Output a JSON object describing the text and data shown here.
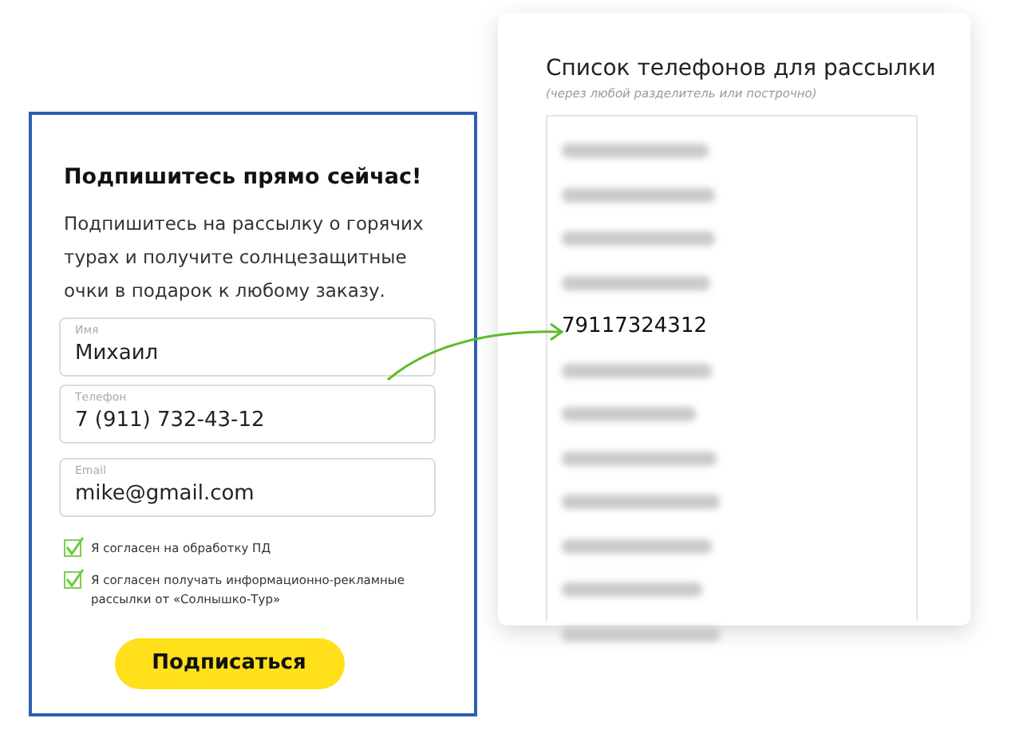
{
  "form": {
    "title": "Подпишитесь прямо сейчас!",
    "description": "Подпишитесь на рассылку о горячих турах и получите солнцезащитные очки в подарок к любому заказу.",
    "fields": [
      {
        "label": "Имя",
        "value": "Михаил"
      },
      {
        "label": "Телефон",
        "value": "7 (911) 732-43-12"
      },
      {
        "label": "Email",
        "value": "mike@gmail.com"
      }
    ],
    "consents": [
      {
        "label": "Я согласен на обработку ПД",
        "checked": true
      },
      {
        "label": "Я согласен получать информационно-рекламные рассылки от «Солнышко-Тур»",
        "checked": true
      }
    ],
    "submit": "Подписаться"
  },
  "phone_list": {
    "title": "Список телефонов для рассылки",
    "hint": "(через любой разделитель или построчно)",
    "entries": [
      {
        "kind": "blurred"
      },
      {
        "kind": "blurred"
      },
      {
        "kind": "blurred"
      },
      {
        "kind": "blurred"
      },
      {
        "kind": "clear",
        "text": "79117324312"
      },
      {
        "kind": "blurred"
      },
      {
        "kind": "blurred"
      },
      {
        "kind": "blurred"
      },
      {
        "kind": "blurred"
      },
      {
        "kind": "blurred"
      },
      {
        "kind": "blurred"
      },
      {
        "kind": "blurred"
      }
    ]
  }
}
